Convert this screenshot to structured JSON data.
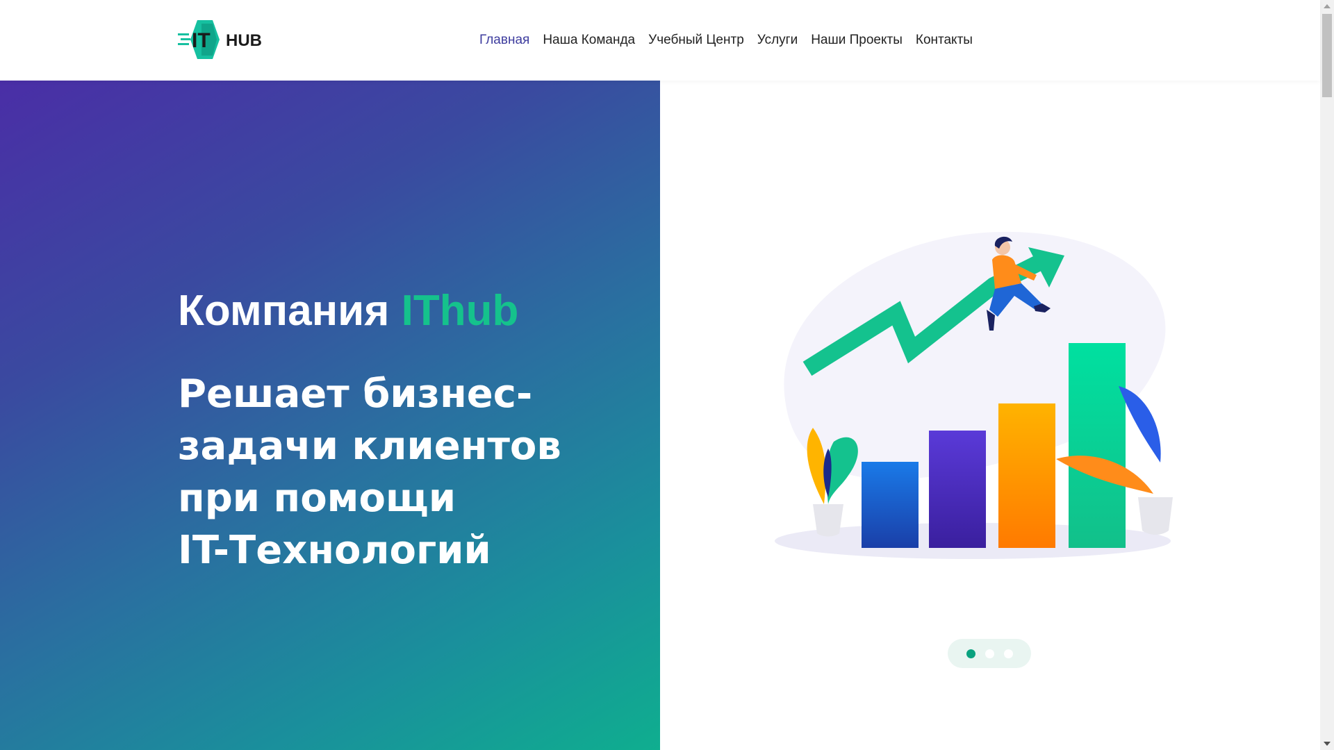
{
  "header": {
    "logo_text_left": "IT",
    "logo_text_right": "HUB",
    "nav": [
      {
        "label": "Главная",
        "active": true
      },
      {
        "label": "Наша Команда",
        "active": false
      },
      {
        "label": "Учебный Центр",
        "active": false
      },
      {
        "label": "Услуги",
        "active": false
      },
      {
        "label": "Наши Проекты",
        "active": false
      },
      {
        "label": "Контакты",
        "active": false
      }
    ]
  },
  "hero": {
    "title_prefix": "Компания ",
    "title_accent": "IThub",
    "subtitle_lines": [
      "Решает бизнес-",
      "задачи клиентов",
      "при помощи",
      "IT-Технологий"
    ]
  },
  "slider": {
    "dots_count": 3,
    "active_index": 0
  },
  "colors": {
    "accent_green": "#15c28c",
    "nav_active": "#3d3c9e",
    "gradient_start": "#4a2ea6",
    "gradient_end": "#0fae8f",
    "dot_active": "#0aa27f"
  },
  "icons": {
    "logo": "ithub-logo-icon",
    "illustration": "growth-chart-illustration"
  }
}
